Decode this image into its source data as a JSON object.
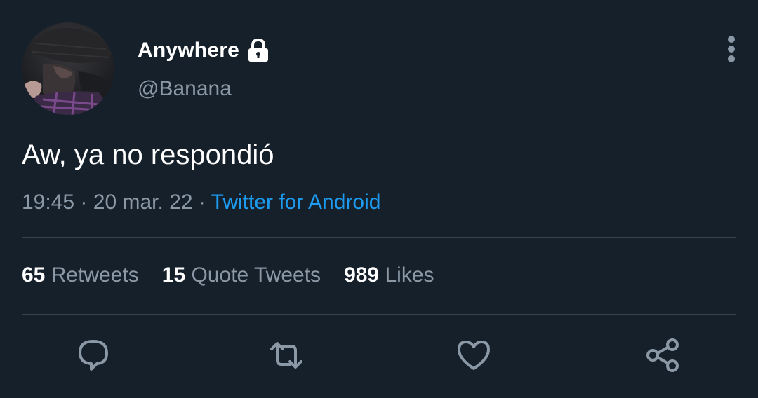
{
  "author": {
    "display_name": "Anywhere",
    "handle": "@Banana",
    "protected_icon": "lock-icon",
    "avatar_icon": "profile-photo"
  },
  "menu_icon": "more-vertical-icon",
  "tweet": {
    "text": "Aw, ya no respondió",
    "time": "19:45",
    "separator": "·",
    "date": "20 mar. 22",
    "source": "Twitter for Android"
  },
  "stats": {
    "retweets": {
      "count": "65",
      "label": "Retweets"
    },
    "quotes": {
      "count": "15",
      "label": "Quote Tweets"
    },
    "likes": {
      "count": "989",
      "label": "Likes"
    }
  },
  "actions": [
    {
      "name": "reply",
      "icon": "reply-icon"
    },
    {
      "name": "retweet",
      "icon": "retweet-icon"
    },
    {
      "name": "like",
      "icon": "heart-icon"
    },
    {
      "name": "share",
      "icon": "share-icon"
    }
  ],
  "colors": {
    "background": "#15202b",
    "primary_text": "#ffffff",
    "secondary_text": "#8b98a5",
    "accent": "#1d9bf0",
    "divider": "#38444d"
  }
}
